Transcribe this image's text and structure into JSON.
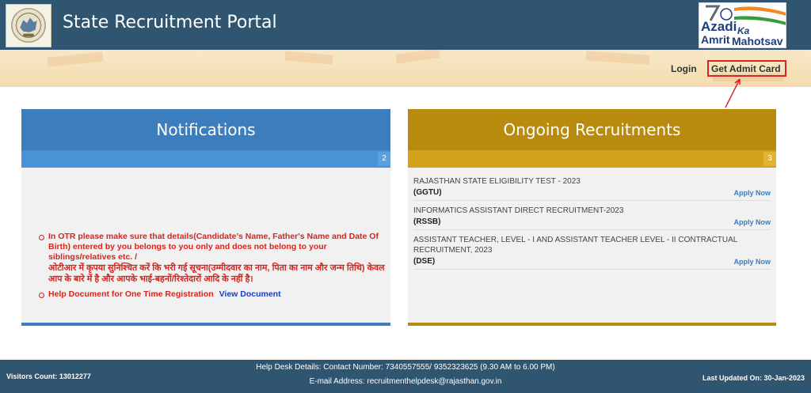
{
  "header": {
    "title": "State Recruitment Portal",
    "badge_lines": [
      "Azadi",
      "Ka",
      "Amrit",
      "Mahotsav"
    ]
  },
  "nav": {
    "login": "Login",
    "admit_card": "Get Admit Card"
  },
  "notifications": {
    "title": "Notifications",
    "count": "2",
    "items": [
      {
        "text_en": "In OTR please make sure that details(Candidate's Name, Father's Name and Date Of Birth) entered by you belongs to you only and does not belong to your siblings/relatives etc. /",
        "text_hi": "ओटीआर में कृपया सुनिश्चित करें कि भरी गई सूचना(उम्मीदवार का नाम, पिता का नाम और जन्म तिथि) केवल आप के बारे में है और आपके भाई-बहनों/रिश्तेदारों आदि के नहीं है।"
      },
      {
        "text_en": "Help Document for One Time Registration",
        "link": "View Document"
      }
    ]
  },
  "recruitments": {
    "title": "Ongoing Recruitments",
    "count": "3",
    "items": [
      {
        "name": "RAJASTHAN STATE ELIGIBILITY TEST - 2023",
        "code": "(GGTU)",
        "action": "Apply Now"
      },
      {
        "name": "INFORMATICS ASSISTANT DIRECT RECRUITMENT-2023",
        "code": "(RSSB)",
        "action": "Apply Now"
      },
      {
        "name": "ASSISTANT TEACHER, LEVEL - I AND ASSISTANT TEACHER LEVEL - II CONTRACTUAL RECRUITMENT, 2023",
        "code": "(DSE)",
        "action": "Apply Now"
      }
    ]
  },
  "footer": {
    "visitors": "Visitors Count: 13012277",
    "help_desk": "Help Desk Details: Contact Number: 7340557555/ 9352323625 (9.30 AM to 6.00 PM)",
    "email": "E-mail Address: recruitmenthelpdesk@rajasthan.gov.in",
    "last_updated": "Last Updated On: 30-Jan-2023"
  },
  "colors": {
    "header_bg": "#2f5571",
    "notifications_blue": "#3b7dbd",
    "recruitments_gold": "#b88a0d",
    "alert_red": "#d9231d",
    "link_blue": "#1a3fbf"
  }
}
